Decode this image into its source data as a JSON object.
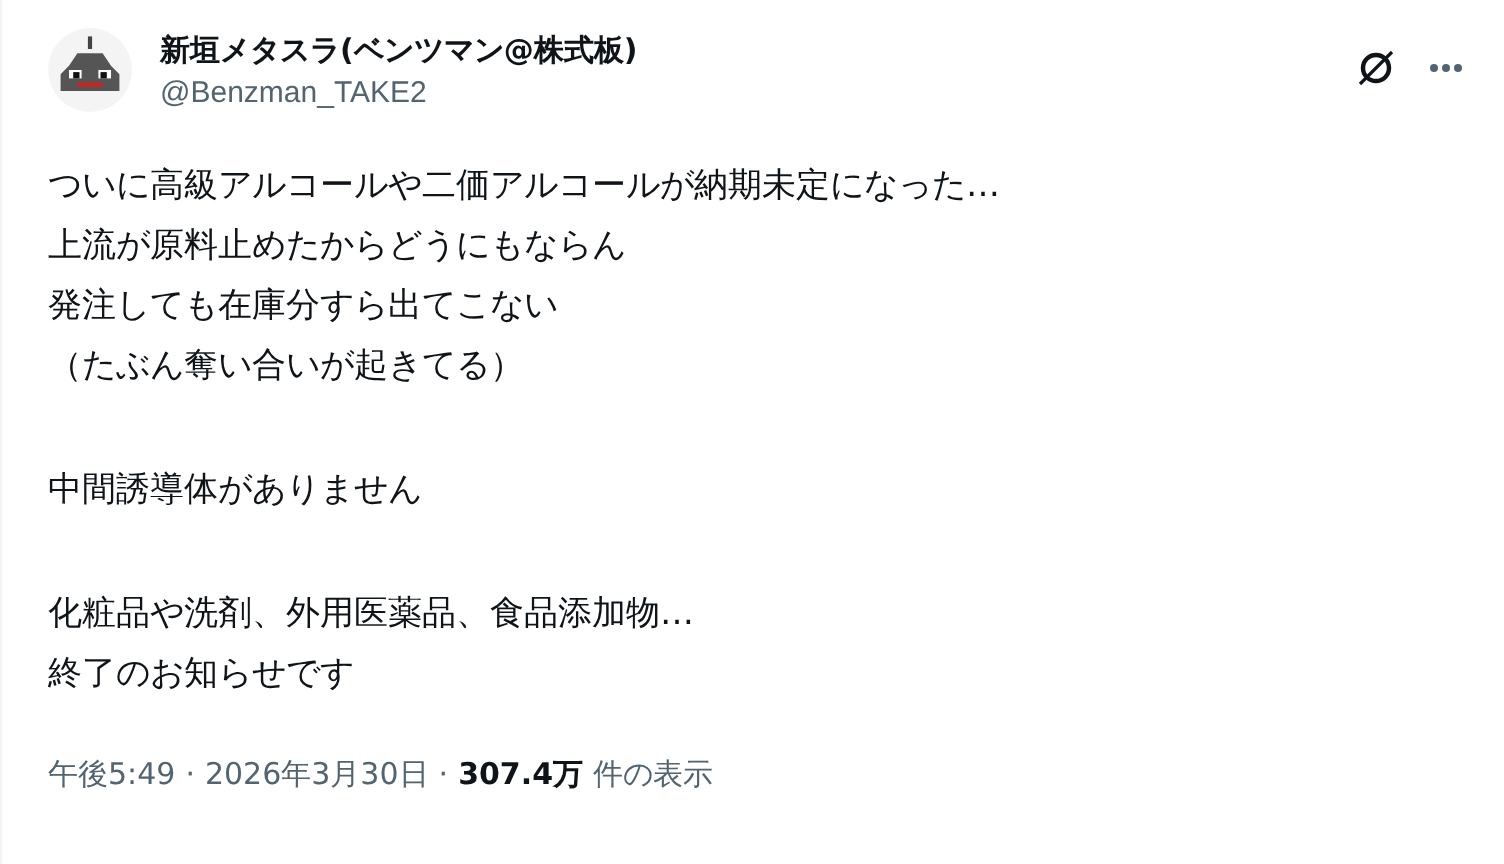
{
  "author": {
    "name": "新垣メタスラ(ベンツマン@株式板)",
    "handle": "@Benzman_TAKE2"
  },
  "body": [
    [
      "ついに高級アルコールや二価アルコールが納期未定になった…",
      "上流が原料止めたからどうにもならん",
      "発注しても在庫分すら出てこない",
      "（たぶん奪い合いが起きてる）"
    ],
    [
      "中間誘導体がありません"
    ],
    [
      "化粧品や洗剤、外用医薬品、食品添加物…",
      "終了のお知らせです"
    ]
  ],
  "meta": {
    "time": "午後5:49",
    "separator_1": "·",
    "date": "2026年3月30日",
    "separator_2": "·",
    "views": "307.4万",
    "views_label": "件の表示"
  }
}
